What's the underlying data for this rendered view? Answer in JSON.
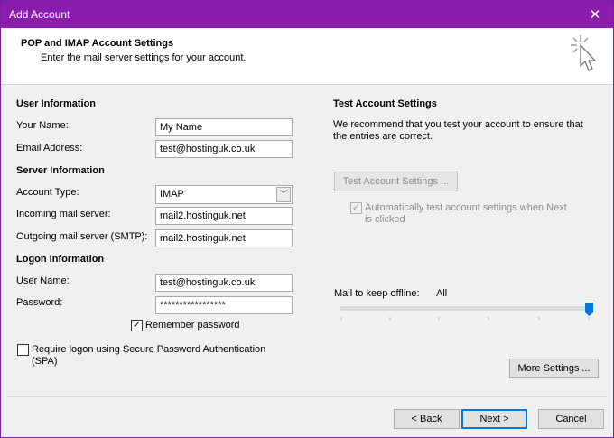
{
  "window": {
    "title": "Add Account",
    "close_glyph": "✕"
  },
  "header": {
    "heading": "POP and IMAP Account Settings",
    "subheading": "Enter the mail server settings for your account."
  },
  "user_info": {
    "section": "User Information",
    "name_label": "Your Name:",
    "name_value": "My Name",
    "email_label": "Email Address:",
    "email_value": "test@hostinguk.co.uk"
  },
  "server_info": {
    "section": "Server Information",
    "account_type_label": "Account Type:",
    "account_type_value": "IMAP",
    "incoming_label": "Incoming mail server:",
    "incoming_value": "mail2.hostinguk.net",
    "outgoing_label": "Outgoing mail server (SMTP):",
    "outgoing_value": "mail2.hostinguk.net"
  },
  "logon_info": {
    "section": "Logon Information",
    "username_label": "User Name:",
    "username_value": "test@hostinguk.co.uk",
    "password_label": "Password:",
    "password_value": "*****************",
    "remember_label": "Remember password",
    "remember_checked": true,
    "spa_label_line1": "Require logon using Secure Password Authentication",
    "spa_label_line2": "(SPA)",
    "spa_checked": false
  },
  "test_settings": {
    "section": "Test Account Settings",
    "description_line1": "We recommend that you test your account to ensure that",
    "description_line2": "the entries are correct.",
    "test_button": "Test Account Settings ...",
    "auto_test_line1": "Automatically test account settings when Next",
    "auto_test_line2": "is clicked",
    "auto_test_checked": true
  },
  "offline": {
    "label": "Mail to keep offline:",
    "value": "All",
    "slider_position": 1.0
  },
  "more_settings_button": "More Settings ...",
  "footer": {
    "back_button": "< Back",
    "next_button": "Next >",
    "cancel_button": "Cancel"
  },
  "icons": {
    "check": "✓",
    "dropdown": "﹀",
    "cursor": "cursor-click-icon"
  },
  "colors": {
    "titlebar": "#8a1cae",
    "accent": "#0078d7"
  }
}
